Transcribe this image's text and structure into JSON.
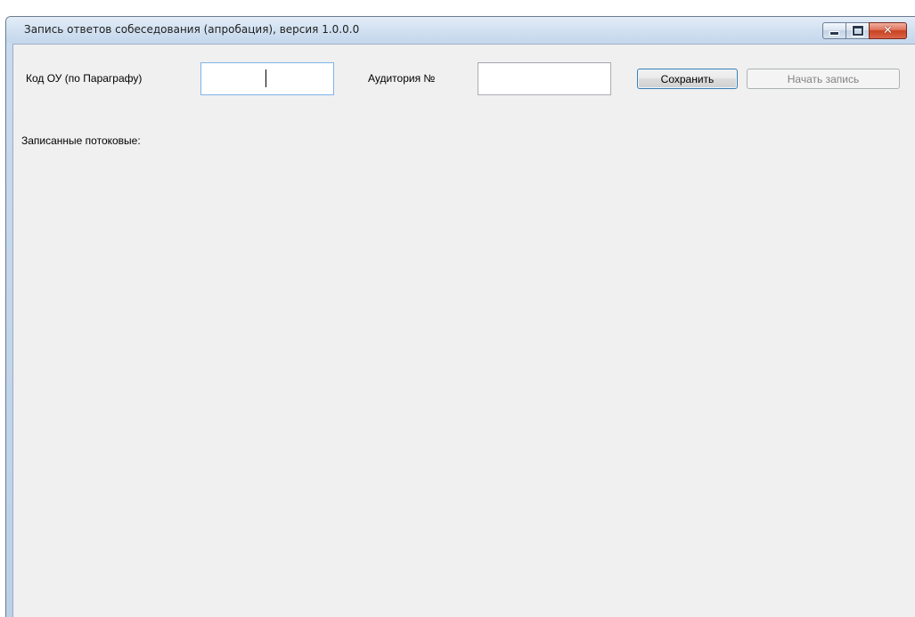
{
  "window": {
    "title": "Запись ответов собеседования (апробация), версия 1.0.0.0",
    "controls": {
      "minimize_icon": "minimize-icon",
      "maximize_icon": "maximize-icon",
      "close_icon": "close-icon",
      "close_glyph": "✕"
    }
  },
  "form": {
    "ou_code_label": "Код ОУ (по Параграфу)",
    "ou_code_value": "",
    "room_label": "Аудитория №",
    "room_value": "",
    "save_label": "Сохранить",
    "start_recording_label": "Начать запись",
    "recorded_streams_label": "Записанные потоковые:"
  },
  "colors": {
    "title_bar": "#d2e1f1",
    "client_background": "#f0f0f0",
    "focus_border": "#7eb4ea",
    "close_button": "#c9421f"
  }
}
